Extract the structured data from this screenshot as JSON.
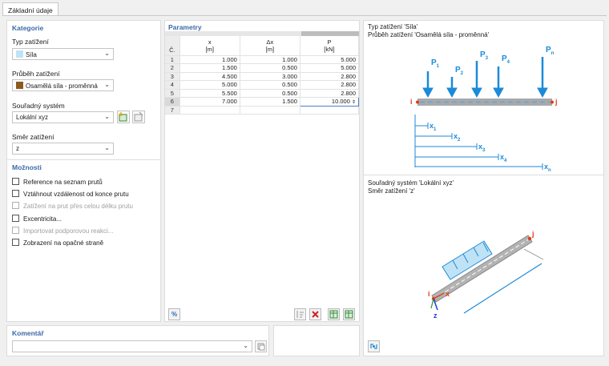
{
  "tab": {
    "label": "Základní údaje"
  },
  "kategorie": {
    "title": "Kategorie",
    "typ_label": "Typ zatížení",
    "typ_value": "Síla",
    "typ_color": "#bfe3f5",
    "prubeh_label": "Průběh zatížení",
    "prubeh_value": "Osamělá síla - proměnná",
    "prubeh_color": "#8b5a1f",
    "souradny_label": "Souřadný systém",
    "souradny_value": "Lokální xyz",
    "smer_label": "Směr zatížení",
    "smer_value": "z"
  },
  "moznosti": {
    "title": "Možnosti",
    "items": [
      {
        "label": "Reference na seznam prutů",
        "enabled": true
      },
      {
        "label": "Vztáhnout vzdálenost od konce prutu",
        "enabled": true
      },
      {
        "label": "Zatížení na prut přes celou délku prutu",
        "enabled": false
      },
      {
        "label": "Excentricita...",
        "enabled": true
      },
      {
        "label": "Importovat podporovou reakci...",
        "enabled": false
      },
      {
        "label": "Zobrazení na opačné straně",
        "enabled": true
      }
    ]
  },
  "parametry": {
    "title": "Parametry",
    "col_no": "Č.",
    "columns": [
      {
        "name": "x",
        "unit": "[m]"
      },
      {
        "name": "Δx",
        "unit": "[m]"
      },
      {
        "name": "P",
        "unit": "[kN]"
      }
    ],
    "rows": [
      {
        "no": "1",
        "x": "1.000",
        "dx": "1.000",
        "p": "5.000"
      },
      {
        "no": "2",
        "x": "1.500",
        "dx": "0.500",
        "p": "5.000"
      },
      {
        "no": "3",
        "x": "4.500",
        "dx": "3.000",
        "p": "2.800"
      },
      {
        "no": "4",
        "x": "5.000",
        "dx": "0.500",
        "p": "2.800"
      },
      {
        "no": "5",
        "x": "5.500",
        "dx": "0.500",
        "p": "2.800"
      },
      {
        "no": "6",
        "x": "7.000",
        "dx": "1.500",
        "p": "10.000"
      },
      {
        "no": "7",
        "x": "",
        "dx": "",
        "p": ""
      }
    ],
    "percent_label": "%"
  },
  "diagram": {
    "line1": "Typ zatížení 'Síla'",
    "line2": "Průběh zatížení 'Osamělá síla - proměnná'",
    "p_labels": [
      "P",
      "P",
      "P",
      "P",
      "P"
    ],
    "p_subs": [
      "1",
      "2",
      "3",
      "4",
      "n"
    ],
    "x_labels": [
      "x",
      "x",
      "x",
      "x",
      "x"
    ],
    "x_subs": [
      "1",
      "2",
      "3",
      "4",
      "n"
    ],
    "node_i": "i",
    "node_j": "j"
  },
  "coord": {
    "line1": "Souřadný systém 'Lokální xyz'",
    "line2": "Směr zatížení 'z'",
    "axis_x": "x",
    "axis_z": "z",
    "node_i": "i",
    "node_j": "j"
  },
  "komentar": {
    "title": "Komentář",
    "value": ""
  }
}
